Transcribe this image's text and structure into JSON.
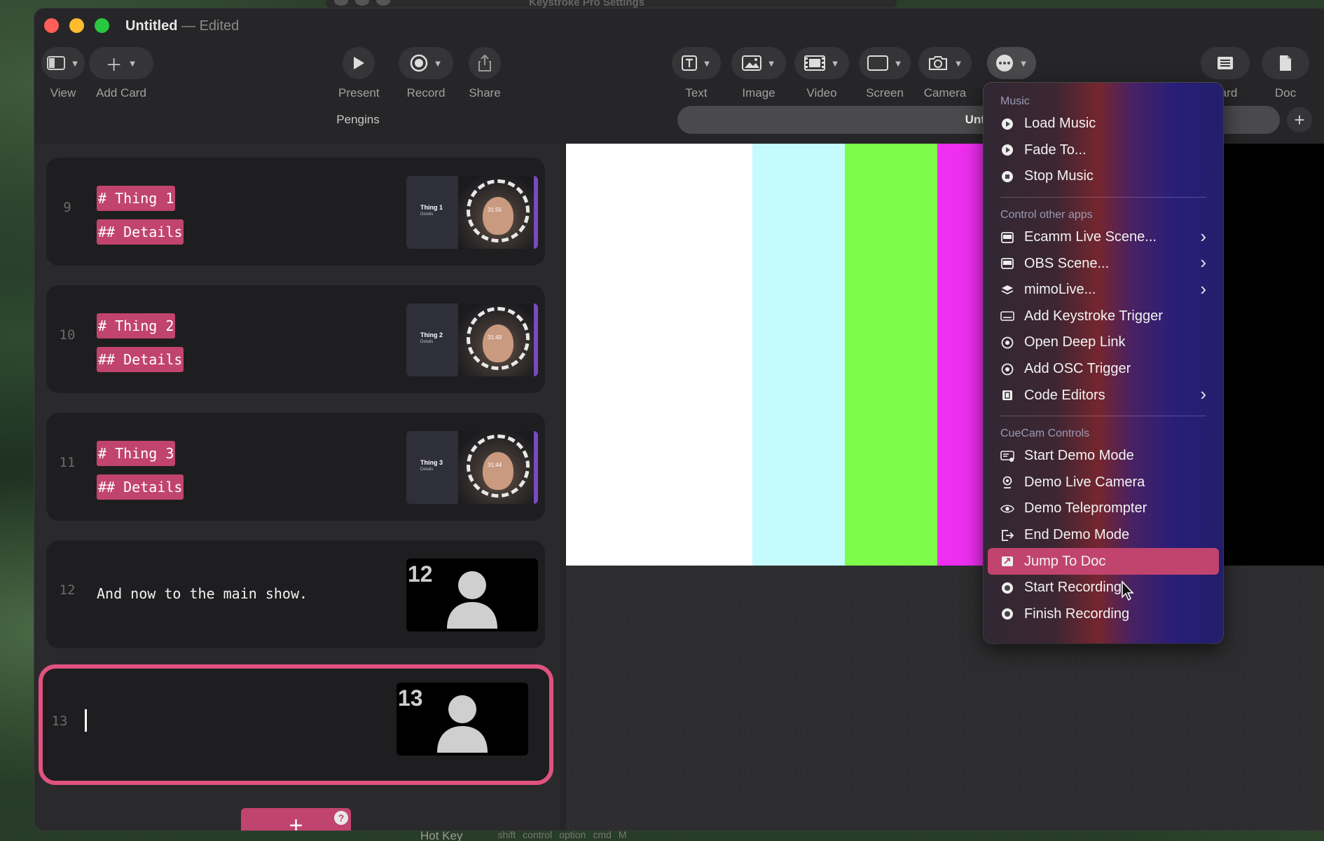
{
  "background_window": {
    "title": "Keystroke Pro Settings"
  },
  "window": {
    "title": "Untitled",
    "separator": "—",
    "status": "Edited"
  },
  "toolbar": {
    "view": "View",
    "add_card": "Add Card",
    "present": "Present",
    "record": "Record",
    "share": "Share",
    "text": "Text",
    "image": "Image",
    "video": "Video",
    "screen": "Screen",
    "camera": "Camera",
    "board": "ard",
    "doc": "Doc"
  },
  "tabs": {
    "left": "Pengins",
    "right": "Untit"
  },
  "cards": [
    {
      "number": "9",
      "heading": "# Thing 1",
      "sub": "## Details",
      "thumb_title": "Thing 1",
      "thumb_sub": "Details",
      "thumb_time": "31:55"
    },
    {
      "number": "10",
      "heading": "# Thing 2",
      "sub": "## Details",
      "thumb_title": "Thing 2",
      "thumb_sub": "Details",
      "thumb_time": "31:49"
    },
    {
      "number": "11",
      "heading": "# Thing 3",
      "sub": "## Details",
      "thumb_title": "Thing 3",
      "thumb_sub": "Details",
      "thumb_time": "31:44"
    },
    {
      "number": "12",
      "text": "And now to the main show.",
      "thumb_num": "12"
    },
    {
      "number": "13",
      "text": "",
      "thumb_num": "13"
    }
  ],
  "add_card_button": {
    "label": "+",
    "help": "?"
  },
  "bottom_peek": {
    "hotkey": "Hot Key",
    "keys": [
      "shift",
      "control",
      "option",
      "cmd",
      "M"
    ]
  },
  "preview": {
    "bar_colors": [
      "#ffffff",
      "#c5fbfd",
      "#7dfc4a",
      "#ee2ef0",
      "#ffff00",
      "#2060e0",
      "#000000"
    ]
  },
  "menu": {
    "sections": [
      {
        "title": "Music",
        "items": [
          {
            "label": "Load Music",
            "icon": "play-circle-icon"
          },
          {
            "label": "Fade To...",
            "icon": "play-circle-icon"
          },
          {
            "label": "Stop Music",
            "icon": "stop-circle-icon"
          }
        ]
      },
      {
        "title": "Control other apps",
        "items": [
          {
            "label": "Ecamm Live Scene...",
            "icon": "window-icon",
            "submenu": true
          },
          {
            "label": "OBS Scene...",
            "icon": "window-icon",
            "submenu": true
          },
          {
            "label": "mimoLive...",
            "icon": "layers-icon",
            "submenu": true
          },
          {
            "label": "Add Keystroke Trigger",
            "icon": "keyboard-icon"
          },
          {
            "label": "Open Deep Link",
            "icon": "target-icon"
          },
          {
            "label": "Add OSC Trigger",
            "icon": "target-icon"
          },
          {
            "label": "Code Editors",
            "icon": "code-icon",
            "submenu": true
          }
        ]
      },
      {
        "title": "CueCam Controls",
        "items": [
          {
            "label": "Start Demo Mode",
            "icon": "screen-icon"
          },
          {
            "label": "Demo Live Camera",
            "icon": "webcam-icon"
          },
          {
            "label": "Demo Teleprompter",
            "icon": "eye-icon"
          },
          {
            "label": "End Demo Mode",
            "icon": "exit-icon"
          },
          {
            "label": "Jump To Doc",
            "icon": "doc-jump-icon",
            "highlighted": true
          },
          {
            "label": "Start Recording",
            "icon": "record-icon"
          },
          {
            "label": "Finish Recording",
            "icon": "record-icon"
          }
        ]
      }
    ]
  },
  "colors": {
    "accent": "#c1446e",
    "selection_border": "#e0527f"
  }
}
